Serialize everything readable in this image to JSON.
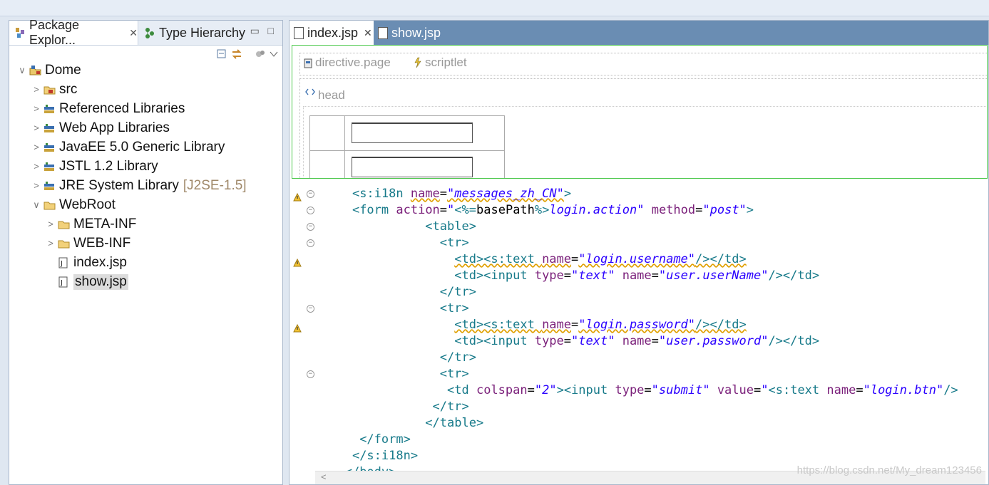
{
  "left_view": {
    "tabs": [
      {
        "label": "Package Explor...",
        "close": "✕"
      },
      {
        "label": "Type Hierarchy"
      }
    ],
    "view_controls": {
      "minimize": "▭",
      "maximize": "□"
    },
    "toolbar": [
      "collapse-all-icon",
      "link-with-editor-icon",
      "filters-icon",
      "view-menu-icon"
    ],
    "tree": [
      {
        "label": "Dome",
        "arrow": "∨",
        "icon": "project-icon"
      },
      {
        "label": "src",
        "arrow": ">",
        "icon": "package-folder-icon"
      },
      {
        "label": "Referenced Libraries",
        "arrow": ">",
        "icon": "library-icon"
      },
      {
        "label": "Web App Libraries",
        "arrow": ">",
        "icon": "library-icon"
      },
      {
        "label": "JavaEE 5.0 Generic Library",
        "arrow": ">",
        "icon": "library-icon"
      },
      {
        "label": "JSTL 1.2 Library",
        "arrow": ">",
        "icon": "library-icon"
      },
      {
        "label": "JRE System Library",
        "suffix": "[J2SE-1.5]",
        "arrow": ">",
        "icon": "library-icon"
      },
      {
        "label": "WebRoot",
        "arrow": "∨",
        "icon": "folder-icon"
      },
      {
        "label": "META-INF",
        "arrow": ">",
        "icon": "folder-icon"
      },
      {
        "label": "WEB-INF",
        "arrow": ">",
        "icon": "folder-icon"
      },
      {
        "label": "index.jsp",
        "arrow": "",
        "icon": "jsp-file-icon"
      },
      {
        "label": "show.jsp",
        "arrow": "",
        "icon": "jsp-file-icon",
        "selected": true
      }
    ]
  },
  "editor": {
    "tabs": [
      {
        "label": "index.jsp",
        "close": "✕",
        "active": true
      },
      {
        "label": "show.jsp",
        "active": false
      }
    ],
    "design": {
      "bar_labels": [
        "directive.page",
        "scriptlet"
      ],
      "head_label": "head"
    },
    "code_lines": [
      {
        "indent": "    ",
        "parts": [
          [
            "tag",
            "<s:i18n "
          ],
          [
            "attr",
            "name"
          ],
          [
            "plain",
            "="
          ],
          [
            "val",
            "\"messages_zh_CN\""
          ],
          [
            "tag",
            ">"
          ]
        ],
        "warn": true,
        "fold": true
      },
      {
        "indent": "    ",
        "parts": [
          [
            "tag",
            "<form "
          ],
          [
            "attr",
            "action"
          ],
          [
            "plain",
            "="
          ],
          [
            "val",
            "\""
          ],
          [
            "tag",
            "<%="
          ],
          [
            "plain",
            "basePath"
          ],
          [
            "tag",
            "%>"
          ],
          [
            "val",
            "login.action\""
          ],
          [
            "plain",
            " "
          ],
          [
            "attr",
            "method"
          ],
          [
            "plain",
            "="
          ],
          [
            "val",
            "\"post\""
          ],
          [
            "tag",
            ">"
          ]
        ],
        "warn": false,
        "fold": true
      },
      {
        "indent": "              ",
        "parts": [
          [
            "tag",
            "<table>"
          ]
        ],
        "warn": false,
        "fold": true
      },
      {
        "indent": "                ",
        "parts": [
          [
            "tag",
            "<tr>"
          ]
        ],
        "warn": false,
        "fold": true
      },
      {
        "indent": "                  ",
        "parts": [
          [
            "tag",
            "<td><s:text "
          ],
          [
            "attr",
            "name"
          ],
          [
            "plain",
            "="
          ],
          [
            "val",
            "\"login.username\""
          ],
          [
            "tag",
            "/></td>"
          ]
        ],
        "warn": true,
        "fold": false
      },
      {
        "indent": "                  ",
        "parts": [
          [
            "tag",
            "<td><input "
          ],
          [
            "attr",
            "type"
          ],
          [
            "plain",
            "="
          ],
          [
            "val",
            "\"text\""
          ],
          [
            "plain",
            " "
          ],
          [
            "attr",
            "name"
          ],
          [
            "plain",
            "="
          ],
          [
            "val",
            "\"user.userName\""
          ],
          [
            "tag",
            "/></td>"
          ]
        ],
        "warn": false,
        "fold": false
      },
      {
        "indent": "                ",
        "parts": [
          [
            "tag",
            "</tr>"
          ]
        ],
        "warn": false,
        "fold": false
      },
      {
        "indent": "                ",
        "parts": [
          [
            "tag",
            "<tr>"
          ]
        ],
        "warn": false,
        "fold": true
      },
      {
        "indent": "                  ",
        "parts": [
          [
            "tag",
            "<td><s:text "
          ],
          [
            "attr",
            "name"
          ],
          [
            "plain",
            "="
          ],
          [
            "val",
            "\"login.password\""
          ],
          [
            "tag",
            "/></td>"
          ]
        ],
        "warn": true,
        "fold": false
      },
      {
        "indent": "                  ",
        "parts": [
          [
            "tag",
            "<td><input "
          ],
          [
            "attr",
            "type"
          ],
          [
            "plain",
            "="
          ],
          [
            "val",
            "\"text\""
          ],
          [
            "plain",
            " "
          ],
          [
            "attr",
            "name"
          ],
          [
            "plain",
            "="
          ],
          [
            "val",
            "\"user.password\""
          ],
          [
            "tag",
            "/></td>"
          ]
        ],
        "warn": false,
        "fold": false
      },
      {
        "indent": "                ",
        "parts": [
          [
            "tag",
            "</tr>"
          ]
        ],
        "warn": false,
        "fold": false
      },
      {
        "indent": "                ",
        "parts": [
          [
            "tag",
            "<tr>"
          ]
        ],
        "warn": false,
        "fold": true
      },
      {
        "indent": "                 ",
        "parts": [
          [
            "tag",
            "<td "
          ],
          [
            "attr",
            "colspan"
          ],
          [
            "plain",
            "="
          ],
          [
            "val",
            "\"2\""
          ],
          [
            "tag",
            "><input "
          ],
          [
            "attr",
            "type"
          ],
          [
            "plain",
            "="
          ],
          [
            "val",
            "\"submit\""
          ],
          [
            "plain",
            " "
          ],
          [
            "attr",
            "value"
          ],
          [
            "plain",
            "="
          ],
          [
            "val",
            "\""
          ],
          [
            "tag",
            "<s:text "
          ],
          [
            "attr",
            "name"
          ],
          [
            "plain",
            "="
          ],
          [
            "val",
            "\"login.btn\""
          ],
          [
            "tag",
            "/>"
          ]
        ],
        "warn": false,
        "fold": false
      },
      {
        "indent": "               ",
        "parts": [
          [
            "tag",
            "</tr>"
          ]
        ],
        "warn": false,
        "fold": false
      },
      {
        "indent": "              ",
        "parts": [
          [
            "tag",
            "</table>"
          ]
        ],
        "warn": false,
        "fold": false
      },
      {
        "indent": "     ",
        "parts": [
          [
            "tag",
            "</form>"
          ]
        ],
        "warn": false,
        "fold": false
      },
      {
        "indent": "    ",
        "parts": [
          [
            "tag",
            "</s:i18n>"
          ]
        ],
        "warn": false,
        "fold": false
      },
      {
        "indent": "   ",
        "parts": [
          [
            "tag",
            "</body>"
          ]
        ],
        "warn": false,
        "fold": false
      }
    ],
    "hscroll_arrow": "<"
  },
  "watermark": "https://blog.csdn.net/My_dream123456",
  "colors": {
    "tag": "#177a8a",
    "attribute": "#7a1f7a",
    "value": "#2a00ff",
    "editor_tabbar": "#6a8db3",
    "design_border": "#4fc94f"
  }
}
